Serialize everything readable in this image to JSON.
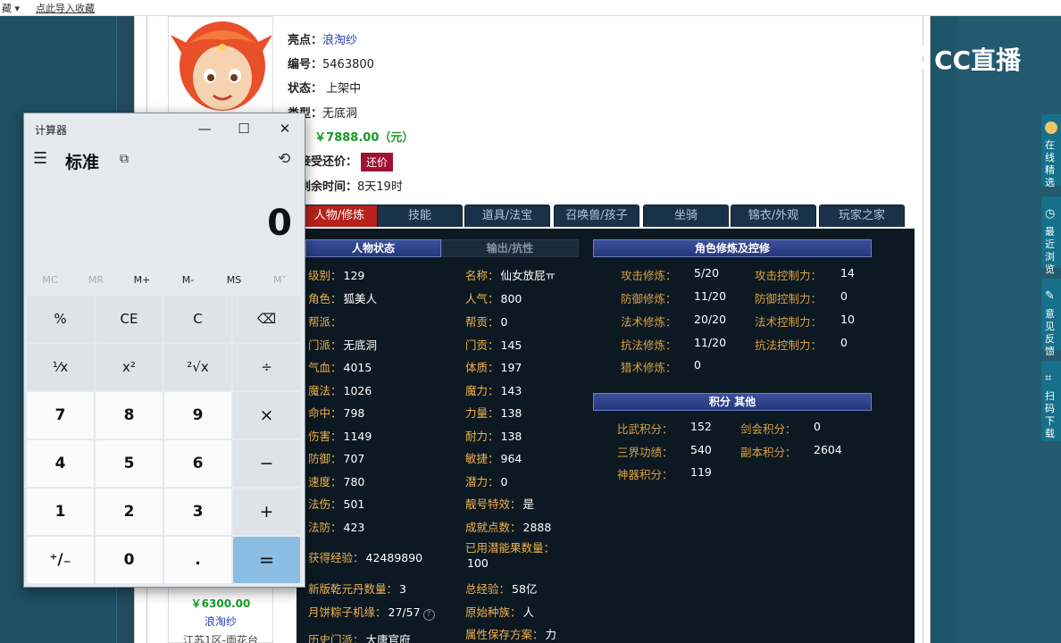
{
  "browser": {
    "bookmark_left": "藏 ▾",
    "bookmark_hint": "点此导入收藏"
  },
  "listing": {
    "rows": [
      {
        "label": "亮点：",
        "value": "浪淘纱"
      },
      {
        "label": "编号：",
        "value": "5463800"
      },
      {
        "label": "状态：",
        "value": "上架中"
      },
      {
        "label": "类型：",
        "value": "无底洞"
      },
      {
        "label": "格：",
        "value": "￥7888.00（元）"
      },
      {
        "label": "否接受还价：",
        "value": ""
      },
      {
        "label": "售剩余时间：",
        "value": "8天19时"
      }
    ],
    "counter_offer_button": "还价"
  },
  "tabs": [
    "人物/修炼",
    "技能",
    "道具/法宝",
    "召唤兽/孩子",
    "坐骑",
    "锦衣/外观",
    "玩家之家"
  ],
  "sections": {
    "char_status": "人物状态",
    "output_resist": "输出/抗性",
    "cultivation": "角色修炼及控修",
    "points_other": "积分 其他"
  },
  "stats_left": [
    {
      "k": "级别：",
      "v": "129"
    },
    {
      "k": "角色：",
      "v": "狐美人"
    },
    {
      "k": "帮派：",
      "v": ""
    },
    {
      "k": "门派：",
      "v": "无底洞"
    },
    {
      "k": "气血：",
      "v": "4015"
    },
    {
      "k": "魔法：",
      "v": "1026"
    },
    {
      "k": "命中：",
      "v": "798"
    },
    {
      "k": "伤害：",
      "v": "1149"
    },
    {
      "k": "防御：",
      "v": "707"
    },
    {
      "k": "速度：",
      "v": "780"
    },
    {
      "k": "法伤：",
      "v": "501"
    },
    {
      "k": "法防：",
      "v": "423"
    },
    {
      "k": "获得经验：",
      "v": "42489890"
    },
    {
      "k": "新版乾元丹数量：",
      "v": "3"
    },
    {
      "k": "月饼粽子机缘：",
      "v": "27/57"
    },
    {
      "k": "历史门派：",
      "v": "大唐官府"
    }
  ],
  "stats_mid": [
    {
      "k": "名称：",
      "v": "仙女放屁ㅠ"
    },
    {
      "k": "人气：",
      "v": "800"
    },
    {
      "k": "帮贡：",
      "v": "0"
    },
    {
      "k": "门贡：",
      "v": "145"
    },
    {
      "k": "体质：",
      "v": "197"
    },
    {
      "k": "魔力：",
      "v": "143"
    },
    {
      "k": "力量：",
      "v": "138"
    },
    {
      "k": "耐力：",
      "v": "138"
    },
    {
      "k": "敏捷：",
      "v": "964"
    },
    {
      "k": "潜力：",
      "v": "0"
    },
    {
      "k": "靓号特效：",
      "v": "是"
    },
    {
      "k": "成就点数：",
      "v": "2888"
    },
    {
      "k": "已用潜能果数量：",
      "v": "100"
    },
    {
      "k": "总经验：",
      "v": "58亿"
    },
    {
      "k": "原始种族：",
      "v": "人"
    },
    {
      "k": "属性保存方案：",
      "v": "力"
    }
  ],
  "cultivation": [
    {
      "k": "攻击修炼：",
      "v": "5/20",
      "k2": "攻击控制力：",
      "v2": "14"
    },
    {
      "k": "防御修炼：",
      "v": "11/20",
      "k2": "防御控制力：",
      "v2": "0"
    },
    {
      "k": "法术修炼：",
      "v": "20/20",
      "k2": "法术控制力：",
      "v2": "10"
    },
    {
      "k": "抗法修炼：",
      "v": "11/20",
      "k2": "抗法控制力：",
      "v2": "0"
    },
    {
      "k": "猎术修炼：",
      "v": "0",
      "k2": "",
      "v2": ""
    }
  ],
  "points": [
    {
      "k": "比武积分：",
      "v": "152",
      "k2": "剑会积分：",
      "v2": "0"
    },
    {
      "k": "三界功绩：",
      "v": "540",
      "k2": "副本积分：",
      "v2": "2604"
    },
    {
      "k": "神器积分：",
      "v": "119",
      "k2": "",
      "v2": ""
    }
  ],
  "card": {
    "price": "￥6300.00",
    "name": "浪淘纱",
    "server": "江苏1区-雨花台"
  },
  "calculator": {
    "title": "计算器",
    "mode": "标准",
    "display": "0",
    "memory": [
      "MC",
      "MR",
      "M+",
      "M-",
      "MS",
      "M˅"
    ],
    "keys": [
      [
        "%",
        "CE",
        "C",
        "⌫"
      ],
      [
        "¹⁄x",
        "x²",
        "²√x",
        "÷"
      ],
      [
        "7",
        "8",
        "9",
        "×"
      ],
      [
        "4",
        "5",
        "6",
        "−"
      ],
      [
        "1",
        "2",
        "3",
        "+"
      ],
      [
        "⁺/₋",
        "0",
        ".",
        "="
      ]
    ]
  },
  "watermark": "CC直播",
  "side_widgets": [
    "在线精选",
    "最近浏览",
    "意见反馈",
    "扫码下载"
  ],
  "colors": {
    "tab_active": "#b6221b",
    "panel": "#0c1922",
    "stat_key": "#f0b24e",
    "price": "#1a9a2a",
    "link": "#2a3eb0"
  }
}
